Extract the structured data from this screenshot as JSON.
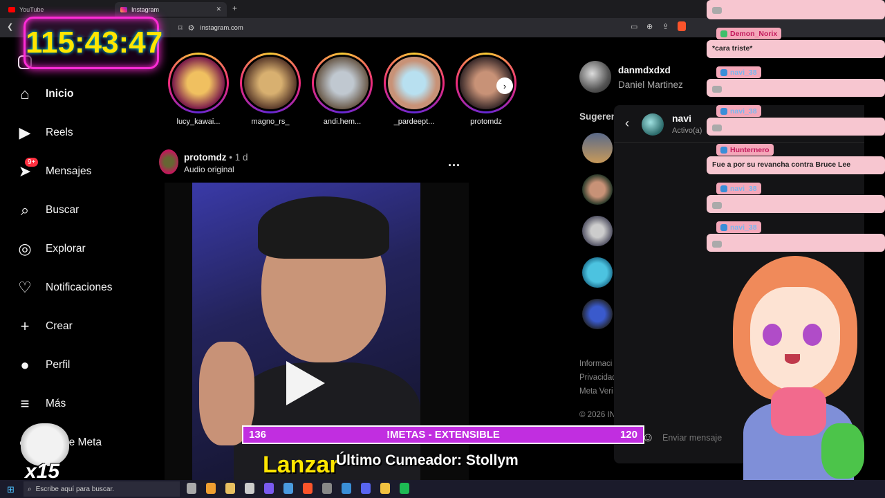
{
  "browser": {
    "tabs": [
      {
        "label": "YouTube",
        "active": false
      },
      {
        "label": "Instagram",
        "active": true
      }
    ],
    "url": "instagram.com"
  },
  "timer": "115:43:47",
  "sidebar": {
    "items": [
      {
        "label": "Inicio",
        "icon": "home-icon",
        "bold": true
      },
      {
        "label": "Reels",
        "icon": "reels-icon"
      },
      {
        "label": "Mensajes",
        "icon": "messages-icon",
        "badge": "9+"
      },
      {
        "label": "Buscar",
        "icon": "search-icon"
      },
      {
        "label": "Explorar",
        "icon": "compass-icon"
      },
      {
        "label": "Notificaciones",
        "icon": "heart-icon"
      },
      {
        "label": "Crear",
        "icon": "plus-icon"
      },
      {
        "label": "Perfil",
        "icon": "avatar-icon"
      },
      {
        "label": "Más",
        "icon": "menu-icon"
      },
      {
        "label": "ién de Meta",
        "icon": "meta-icon"
      }
    ]
  },
  "stories": [
    "lucy_kawai...",
    "magno_rs_",
    "andi.hem...",
    "_pardeept...",
    "protomdz"
  ],
  "post": {
    "author": "protomdz",
    "time": "• 1 d",
    "audio": "Audio original",
    "more": "..."
  },
  "profile": {
    "username": "danmdxdxd",
    "name": "Daniel Martinez"
  },
  "suggestions_title": "Sugeren",
  "footer": [
    "Informaci",
    "Privacidad",
    "Meta Veri",
    "© 2026 IN"
  ],
  "dm": {
    "name": "navi",
    "status": "Activo(a)",
    "input_placeholder": "Enviar mensaje"
  },
  "chat": [
    {
      "user": "Demon_Norix",
      "message": "*cara triste*"
    },
    {
      "user": "navi_38",
      "message": ""
    },
    {
      "user": "navi_38",
      "message": ""
    },
    {
      "user": "Hunternero",
      "message": "Fue a por su revancha contra Bruce Lee"
    },
    {
      "user": "navi_38",
      "message": ""
    },
    {
      "user": "navi_38",
      "message": ""
    }
  ],
  "goal_bar": {
    "left": "136",
    "label": "!METAS - EXTENSIBLE",
    "right": "120"
  },
  "launch_text": "Lanzar",
  "last_cum": "Último Cumeador: Stollym",
  "multiplier": "x15",
  "taskbar": {
    "search_placeholder": "Escribe aquí para buscar."
  },
  "colors": {
    "timer_glow": "#ff2bd6",
    "timer_text": "#ffe600",
    "goal_bar": "#c12ee0",
    "chat_bubble": "#f7c6d0",
    "chat_user": "#c2185b"
  }
}
